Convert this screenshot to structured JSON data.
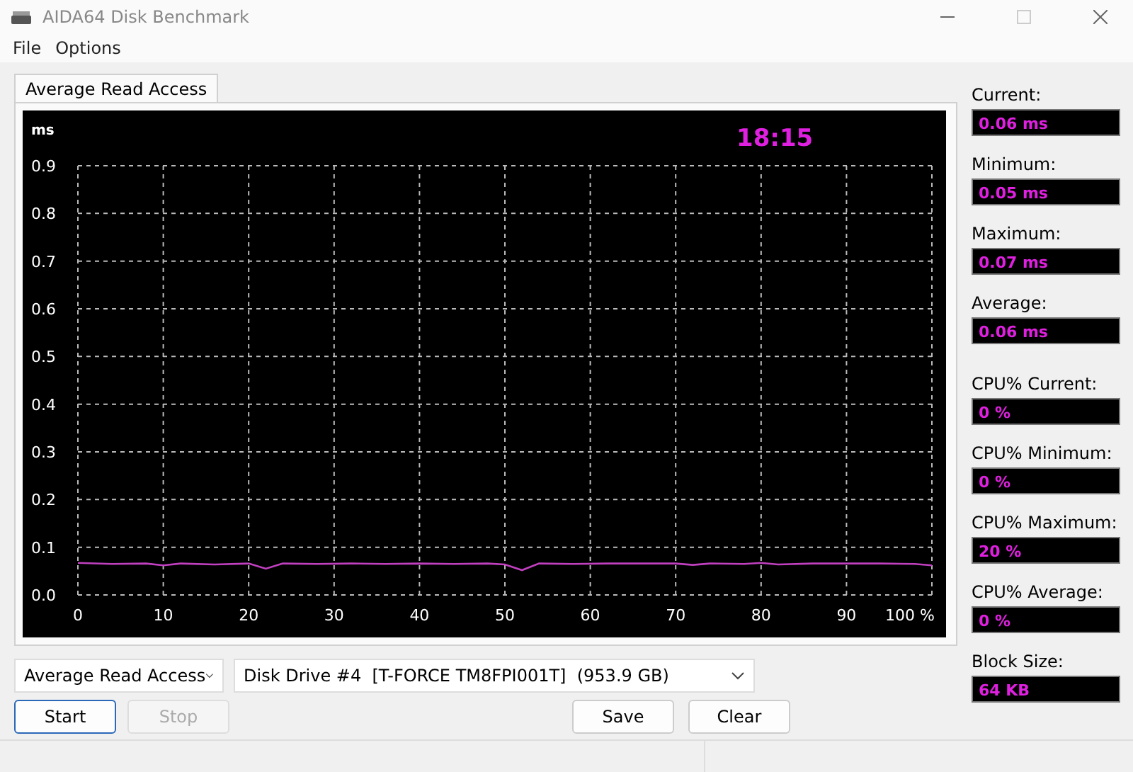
{
  "window": {
    "title": "AIDA64 Disk Benchmark"
  },
  "menu": [
    {
      "label": "File"
    },
    {
      "label": "Options"
    }
  ],
  "tabs": [
    {
      "label": "Average Read Access",
      "selected": true
    }
  ],
  "chart": {
    "time": "18:15",
    "chart_data": {
      "type": "line",
      "ylabel": "ms",
      "xlim": [
        0,
        100
      ],
      "ylim": [
        0,
        0.9
      ],
      "xticks": [
        0,
        10,
        20,
        30,
        40,
        50,
        60,
        70,
        80,
        90,
        {
          "value": 100,
          "label": "100 %"
        }
      ],
      "yticks": [
        {
          "value": 0,
          "label": "0.0"
        },
        0.1,
        0.2,
        0.3,
        0.4,
        0.5,
        0.6,
        0.7,
        0.8,
        0.9
      ],
      "x": [
        0,
        4,
        8,
        10,
        12,
        16,
        20,
        22,
        24,
        28,
        32,
        36,
        40,
        44,
        48,
        50,
        52,
        54,
        58,
        62,
        66,
        70,
        72,
        74,
        78,
        80,
        82,
        86,
        90,
        94,
        98,
        100
      ],
      "grid": true,
      "series": [
        {
          "color": "#c040c0",
          "values": [
            0.067,
            0.065,
            0.066,
            0.062,
            0.066,
            0.064,
            0.066,
            0.055,
            0.066,
            0.065,
            0.066,
            0.065,
            0.066,
            0.065,
            0.066,
            0.064,
            0.052,
            0.066,
            0.065,
            0.066,
            0.066,
            0.066,
            0.063,
            0.066,
            0.065,
            0.067,
            0.064,
            0.066,
            0.066,
            0.066,
            0.065,
            0.062
          ]
        }
      ]
    }
  },
  "controls": {
    "test_select": {
      "value": "Average Read Access"
    },
    "drive_select": {
      "value": "Disk Drive #4  [T-FORCE TM8FPI001T]  (953.9 GB)"
    }
  },
  "buttons": [
    {
      "label": "Start",
      "disabled": false,
      "default": true
    },
    {
      "label": "Stop",
      "disabled": true,
      "default": false
    },
    {
      "label": "Save",
      "disabled": false,
      "default": false
    },
    {
      "label": "Clear",
      "disabled": false,
      "default": false
    }
  ],
  "stats": [
    {
      "label": "Current:",
      "value": "0.06 ms"
    },
    {
      "label": "Minimum:",
      "value": "0.05 ms"
    },
    {
      "label": "Maximum:",
      "value": "0.07 ms"
    },
    {
      "label": "Average:",
      "value": "0.06 ms"
    },
    {
      "label": "CPU% Current:",
      "value": "0 %"
    },
    {
      "label": "CPU% Minimum:",
      "value": "0 %"
    },
    {
      "label": "CPU% Maximum:",
      "value": "20 %"
    },
    {
      "label": "CPU% Average:",
      "value": "0 %"
    },
    {
      "label": "Block Size:",
      "value": "64 KB"
    }
  ]
}
